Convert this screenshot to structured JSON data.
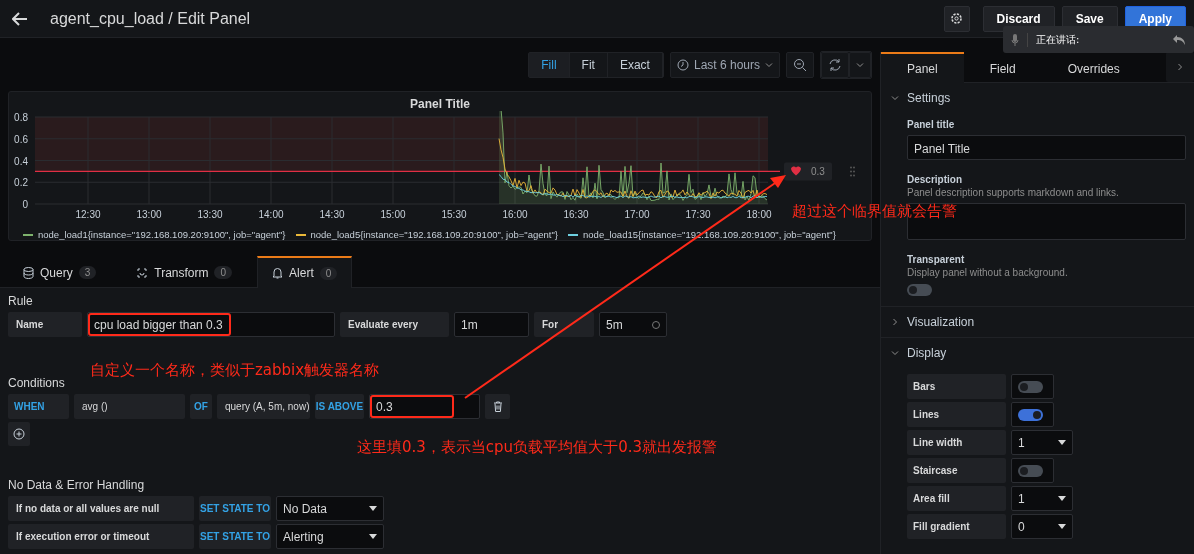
{
  "header": {
    "title": "agent_cpu_load / Edit Panel",
    "buttons": [
      {
        "label": "Discard",
        "kind": "secondary"
      },
      {
        "label": "Save",
        "kind": "secondary"
      },
      {
        "label": "Apply",
        "kind": "primary"
      }
    ]
  },
  "voice_popup": {
    "text": "正在讲话:"
  },
  "toolbar": {
    "view_modes": [
      {
        "label": "Fill",
        "selected": true
      },
      {
        "label": "Fit",
        "selected": false
      },
      {
        "label": "Exact",
        "selected": false
      }
    ],
    "time_range": "Last 6 hours"
  },
  "graph": {
    "title": "Panel Title",
    "y_ticks": [
      "0.8",
      "0.6",
      "0.4",
      "0.2",
      "0"
    ],
    "x_ticks": [
      "12:30",
      "13:00",
      "13:30",
      "14:00",
      "14:30",
      "15:00",
      "15:30",
      "16:00",
      "16:30",
      "17:00",
      "17:30",
      "18:00"
    ],
    "threshold": "0.3",
    "legend": [
      {
        "label": "node_load1{instance=\"192.168.109.20:9100\", job=\"agent\"}",
        "color": "#7eb26d"
      },
      {
        "label": "node_load5{instance=\"192.168.109.20:9100\", job=\"agent\"}",
        "color": "#eab839"
      },
      {
        "label": "node_load15{instance=\"192.168.109.20:9100\", job=\"agent\"}",
        "color": "#6ed0e0"
      }
    ]
  },
  "query_tabs": [
    {
      "label": "Query",
      "count": "3",
      "kind": "query",
      "selected": false
    },
    {
      "label": "Transform",
      "count": "0",
      "kind": "transform",
      "selected": false
    },
    {
      "label": "Alert",
      "count": "0",
      "kind": "alert",
      "selected": true
    }
  ],
  "alert": {
    "rule_title": "Rule",
    "name_label": "Name",
    "name_value": "cpu load bigger than 0.3",
    "evaluate_label": "Evaluate every",
    "evaluate_value": "1m",
    "for_label": "For",
    "for_value": "5m",
    "conditions_title": "Conditions",
    "condition": {
      "when": "WHEN",
      "reducer": "avg ()",
      "of": "OF",
      "query": "query (A, 5m, now)",
      "evaluator": "IS ABOVE",
      "value": "0.3"
    },
    "no_data_title": "No Data & Error Handling",
    "handling": [
      {
        "label": "If no data or all values are null",
        "action": "SET STATE TO",
        "value": "No Data"
      },
      {
        "label": "If execution error or timeout",
        "action": "SET STATE TO",
        "value": "Alerting"
      }
    ]
  },
  "options_panel": {
    "tabs": [
      {
        "label": "Panel",
        "selected": true
      },
      {
        "label": "Field",
        "selected": false
      },
      {
        "label": "Overrides",
        "selected": false
      }
    ],
    "settings": {
      "title": "Settings",
      "expanded": true,
      "panel_title_label": "Panel title",
      "panel_title_value": "Panel Title",
      "description_label": "Description",
      "description_help": "Panel description supports markdown and links.",
      "transparent_label": "Transparent",
      "transparent_help": "Display panel without a background.",
      "transparent_on": false
    },
    "visualization": {
      "title": "Visualization",
      "expanded": false
    },
    "display": {
      "title": "Display",
      "expanded": true,
      "rows": [
        {
          "label": "Bars",
          "kind": "toggle",
          "on": false
        },
        {
          "label": "Lines",
          "kind": "toggle",
          "on": true
        },
        {
          "label": "Line width",
          "kind": "select",
          "value": "1"
        },
        {
          "label": "Staircase",
          "kind": "toggle",
          "on": false
        },
        {
          "label": "Area fill",
          "kind": "select",
          "value": "1"
        },
        {
          "label": "Fill gradient",
          "kind": "select",
          "value": "0"
        }
      ]
    }
  },
  "annotations": [
    {
      "text": "超过这个临界值就会告警",
      "kind": "threshold-note"
    },
    {
      "text": "自定义一个名称，类似于zabbix触发器名称",
      "kind": "name-note"
    },
    {
      "text": "这里填0.3，表示当cpu负载平均值大于0.3就出发报警",
      "kind": "value-note"
    }
  ]
}
